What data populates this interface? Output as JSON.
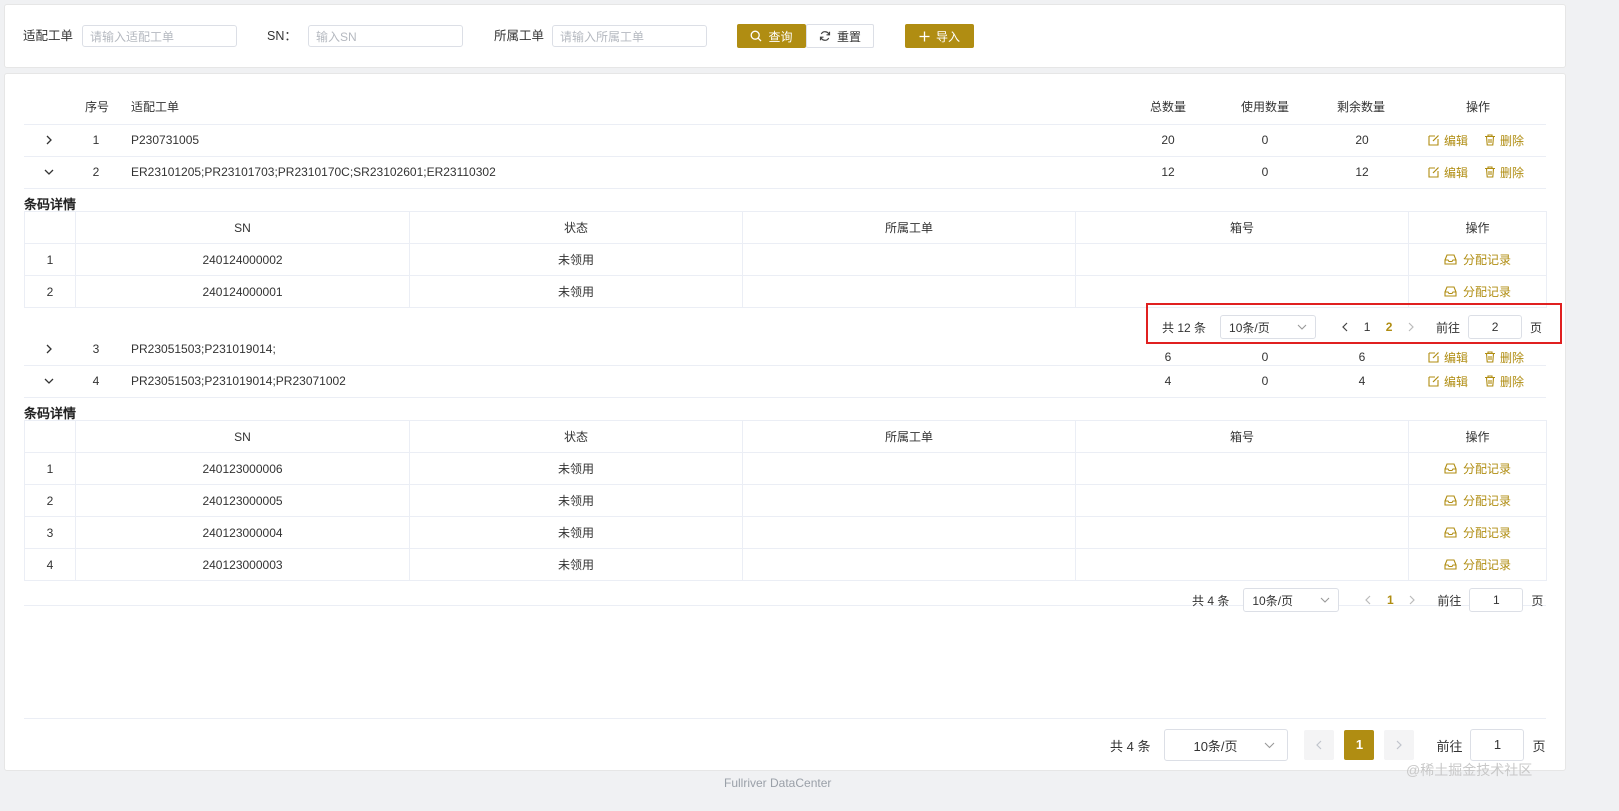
{
  "search": {
    "fields": [
      {
        "label": "适配工单",
        "placeholder": "请输入适配工单"
      },
      {
        "label": "SN：",
        "placeholder": "输入SN"
      },
      {
        "label": "所属工单",
        "placeholder": "请输入所属工单"
      }
    ],
    "query_label": "查询",
    "reset_label": "重置",
    "import_label": "导入"
  },
  "table": {
    "headers": {
      "index": "序号",
      "order": "适配工单",
      "total": "总数量",
      "used": "使用数量",
      "remain": "剩余数量",
      "ops": "操作"
    },
    "edit_label": "编辑",
    "delete_label": "删除",
    "rows": [
      {
        "index": "1",
        "order": "P230731005",
        "total": "20",
        "used": "0",
        "remain": "20",
        "expanded": false
      },
      {
        "index": "2",
        "order": "ER23101205;PR23101703;PR2310170C;SR23102601;ER23110302",
        "total": "12",
        "used": "0",
        "remain": "12",
        "expanded": true
      },
      {
        "index": "3",
        "order": "PR23051503;P231019014;",
        "total": "6",
        "used": "0",
        "remain": "6",
        "expanded": false
      },
      {
        "index": "4",
        "order": "PR23051503;P231019014;PR23071002",
        "total": "4",
        "used": "0",
        "remain": "4",
        "expanded": true
      }
    ]
  },
  "details": [
    {
      "title": "条码详情",
      "headers": {
        "sn": "SN",
        "status": "状态",
        "order": "所属工单",
        "box": "箱号",
        "ops": "操作"
      },
      "action_label": "分配记录",
      "rows": [
        {
          "index": "1",
          "sn": "240124000002",
          "status": "未领用",
          "order": "",
          "box": ""
        },
        {
          "index": "2",
          "sn": "240124000001",
          "status": "未领用",
          "order": "",
          "box": ""
        }
      ],
      "pagination": {
        "total": "共 12 条",
        "page_size": "10条/页",
        "pages": [
          "1",
          "2"
        ],
        "current": "2",
        "goto_label": "前往",
        "goto_value": "2",
        "page_suffix": "页"
      }
    },
    {
      "title": "条码详情",
      "headers": {
        "sn": "SN",
        "status": "状态",
        "order": "所属工单",
        "box": "箱号",
        "ops": "操作"
      },
      "action_label": "分配记录",
      "rows": [
        {
          "index": "1",
          "sn": "240123000006",
          "status": "未领用",
          "order": "",
          "box": ""
        },
        {
          "index": "2",
          "sn": "240123000005",
          "status": "未领用",
          "order": "",
          "box": ""
        },
        {
          "index": "3",
          "sn": "240123000004",
          "status": "未领用",
          "order": "",
          "box": ""
        },
        {
          "index": "4",
          "sn": "240123000003",
          "status": "未领用",
          "order": "",
          "box": ""
        }
      ],
      "pagination": {
        "total": "共 4 条",
        "page_size": "10条/页",
        "pages": [
          "1"
        ],
        "current": "1",
        "goto_label": "前往",
        "goto_value": "1",
        "page_suffix": "页"
      }
    }
  ],
  "main_pagination": {
    "total": "共 4 条",
    "page_size": "10条/页",
    "current": "1",
    "goto_label": "前往",
    "goto_value": "1",
    "page_suffix": "页"
  },
  "footer": "Fullriver DataCenter",
  "watermark": "@稀土掘金技术社区",
  "colors": {
    "accent": "#b08d12",
    "highlight": "#e02020"
  }
}
